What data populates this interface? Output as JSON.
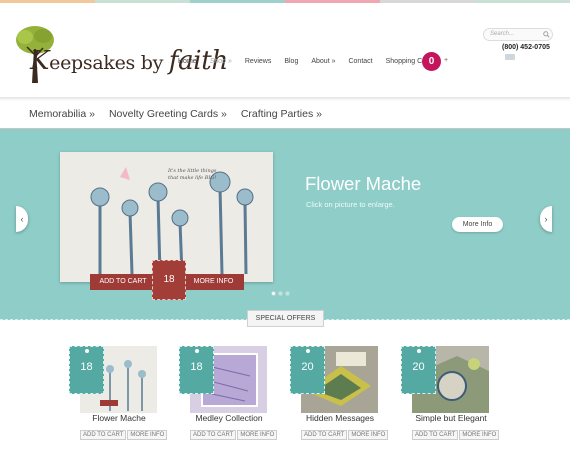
{
  "brand": {
    "logo_text_prefix": "K",
    "logo_text_rest": "eepsakes by ",
    "logo_text_accent": "faith",
    "tree_color": "#94b13a"
  },
  "topbar_colors": [
    "#f0c89c",
    "#c8e1d4",
    "#9fd1cc",
    "#f1a7b1",
    "#d8d8d8",
    "#c8e1d4"
  ],
  "nav": {
    "items": [
      "Home",
      "Shop »",
      "Reviews",
      "Blog",
      "About »",
      "Contact",
      "Shopping Cart"
    ],
    "cart_count": "0",
    "cart_plus": "+"
  },
  "search": {
    "placeholder": "Search..."
  },
  "contact": {
    "phone": "(800) 452-0705"
  },
  "categories": [
    "Memorabilia »",
    "Novelty Greeting Cards »",
    "Crafting Parties »"
  ],
  "hero": {
    "title": "Flower Mache",
    "subtitle": "Click on picture to enlarge.",
    "more_info": "More Info",
    "add_to_cart": "ADD TO CART",
    "more_info_small": "MORE INFO",
    "price": "18",
    "active_dot": 0,
    "bg_color": "#8fcdc9"
  },
  "special_offers": "SPECIAL OFFERS",
  "products": [
    {
      "name": "Flower Mache",
      "price": "18",
      "add": "ADD TO CART",
      "more": "MORE INFO"
    },
    {
      "name": "Medley Collection",
      "price": "18",
      "add": "ADD TO CART",
      "more": "MORE INFO"
    },
    {
      "name": "Hidden Messages",
      "price": "20",
      "add": "ADD TO CART",
      "more": "MORE INFO"
    },
    {
      "name": "Simple but Elegant",
      "price": "20",
      "add": "ADD TO CART",
      "more": "MORE INFO"
    }
  ]
}
